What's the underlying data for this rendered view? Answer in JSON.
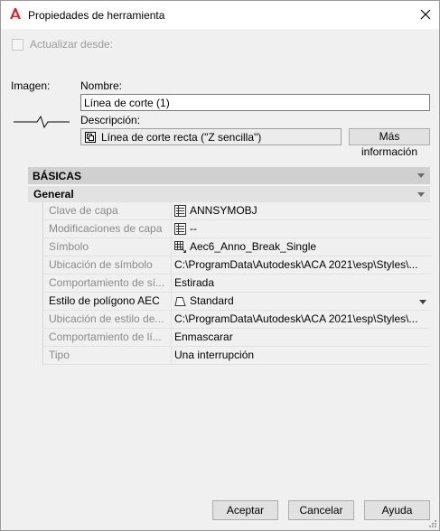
{
  "window": {
    "title": "Propiedades de herramienta"
  },
  "update_from": {
    "label": "Actualizar desde:",
    "checked": false
  },
  "image": {
    "label": "Imagen:"
  },
  "name": {
    "label": "Nombre:",
    "value": "Línea de corte (1)"
  },
  "description": {
    "label": "Descripción:",
    "value": "Línea de corte recta (\"Z sencilla\")",
    "more_info_label": "Más información"
  },
  "properties": {
    "section_label": "BÁSICAS",
    "subsection_label": "General",
    "rows": [
      {
        "name": "Clave de capa",
        "value": "ANNSYMOBJ",
        "icon": "layer-key-icon",
        "enabled": false
      },
      {
        "name": "Modificaciones de capa",
        "value": "--",
        "icon": "layer-overrides-icon",
        "enabled": false
      },
      {
        "name": "Símbolo",
        "value": "Aec6_Anno_Break_Single",
        "icon": "symbol-block-icon",
        "enabled": false
      },
      {
        "name": "Ubicación de símbolo",
        "value": "C:\\ProgramData\\Autodesk\\ACA  2021\\esp\\Styles\\...",
        "icon": "",
        "enabled": false
      },
      {
        "name": "Comportamiento de sí...",
        "value": "Estirada",
        "icon": "",
        "enabled": false
      },
      {
        "name": "Estilo de polígono AEC",
        "value": "Standard",
        "icon": "polygon-style-icon",
        "enabled": true,
        "dropdown": true
      },
      {
        "name": "Ubicación de estilo de...",
        "value": "C:\\ProgramData\\Autodesk\\ACA  2021\\esp\\Styles\\...",
        "icon": "",
        "enabled": false
      },
      {
        "name": "Comportamiento de lí...",
        "value": "Enmascarar",
        "icon": "",
        "enabled": false
      },
      {
        "name": "Tipo",
        "value": "Una interrupción",
        "icon": "",
        "enabled": false
      }
    ]
  },
  "buttons": {
    "ok": "Aceptar",
    "cancel": "Cancelar",
    "help": "Ayuda"
  },
  "colors": {
    "app_icon_red": "#d9242a",
    "window_bg": "#f0f0f0",
    "section_bg": "#d0d0d0"
  }
}
